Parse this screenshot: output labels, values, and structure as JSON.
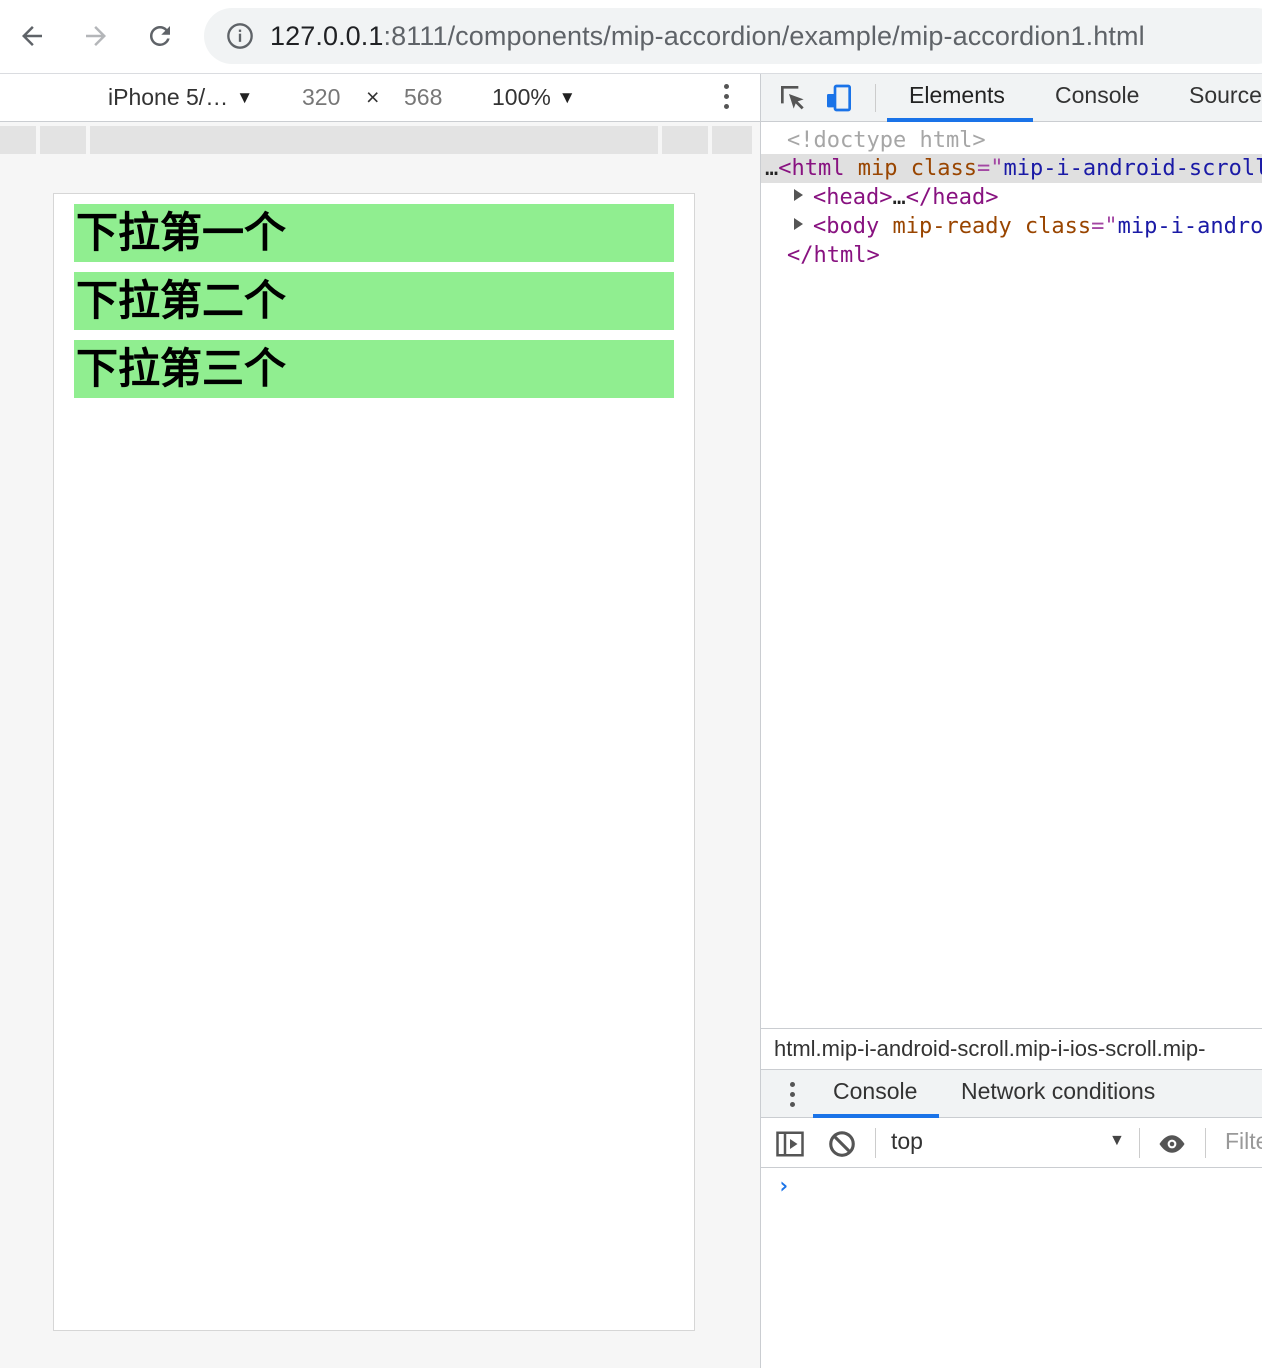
{
  "browser": {
    "url_host": "127.0.0.1",
    "url_rest": ":8111/components/mip-accordion/example/mip-accordion1.html"
  },
  "device_bar": {
    "device": "iPhone 5/…",
    "width": "320",
    "times": "×",
    "height": "568",
    "zoom": "100%"
  },
  "page": {
    "accordion_items": [
      "下拉第一个",
      "下拉第二个",
      "下拉第三个"
    ],
    "item_color": "#90ee90"
  },
  "devtools": {
    "tabs": [
      "Elements",
      "Console",
      "Sources"
    ],
    "active_tab": "Elements",
    "elements": {
      "doctype": "<!doctype html>",
      "ellipsis": "…",
      "html_open_tag": "<html",
      "html_attr1": " mip",
      "html_attr2": " class",
      "html_eq": "=\"",
      "html_class_val": "mip-i-android-scroll",
      "head_open": "<head>",
      "head_dots": "…",
      "head_close": "</head>",
      "body_open": "<body",
      "body_attr1": " mip-ready",
      "body_attr2": " class",
      "body_eq": "=\"",
      "body_class_val": "mip-i-android",
      "html_close": "</html>"
    },
    "breadcrumb": "html.mip-i-android-scroll.mip-i-ios-scroll.mip-",
    "drawer_tabs": [
      "Console",
      "Network conditions"
    ],
    "console": {
      "context": "top",
      "filter_placeholder": "Filter",
      "prompt": "›"
    }
  }
}
